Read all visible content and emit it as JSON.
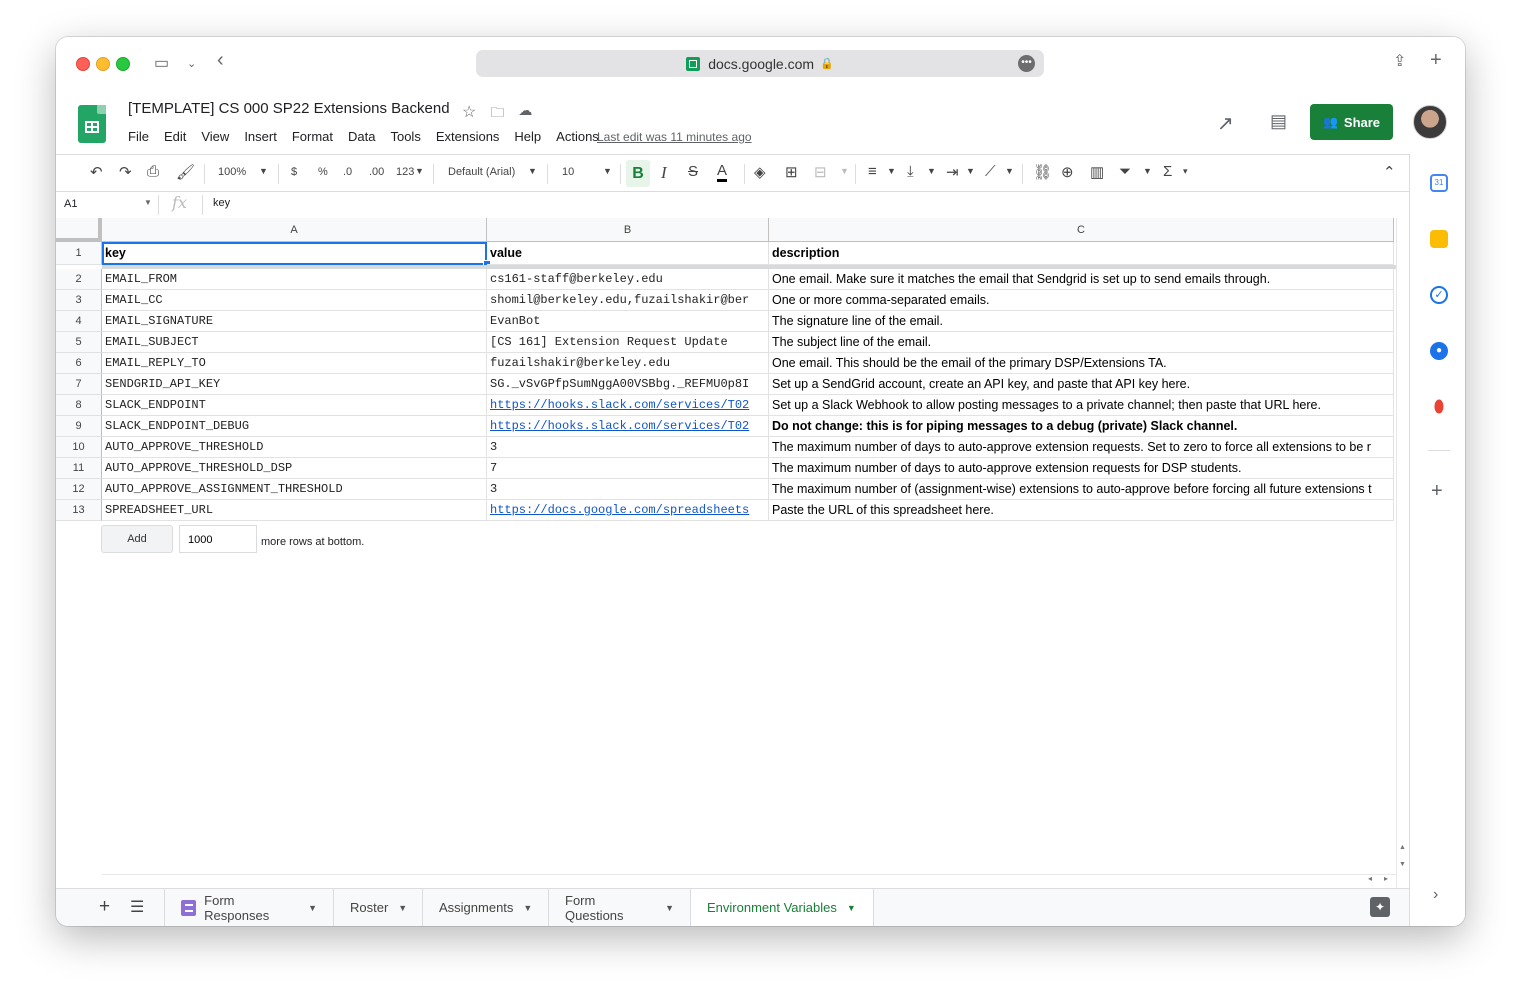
{
  "browser": {
    "url": "docs.google.com"
  },
  "doc": {
    "title": "[TEMPLATE] CS 000 SP22 Extensions Backend",
    "menu": [
      "File",
      "Edit",
      "View",
      "Insert",
      "Format",
      "Data",
      "Tools",
      "Extensions",
      "Help",
      "Actions"
    ],
    "last_edit": "Last edit was 11 minutes ago",
    "share_label": "Share"
  },
  "toolbar": {
    "zoom": "100%",
    "currency": "$",
    "percent": "%",
    "dec_decrease": ".0",
    "dec_increase": ".00",
    "more_formats": "123",
    "font": "Default (Arial)",
    "font_size": "10",
    "bold": "B",
    "italic": "I",
    "strike": "S",
    "text_color": "A"
  },
  "formula_bar": {
    "cell_ref": "A1",
    "fx": "fx",
    "value": "key"
  },
  "columns": [
    "A",
    "B",
    "C"
  ],
  "rows": [
    {
      "n": "1",
      "key": "key",
      "value": "value",
      "description": "description"
    },
    {
      "n": "2",
      "key": "EMAIL_FROM",
      "value": "cs161-staff@berkeley.edu",
      "description": "One email. Make sure it matches the email that Sendgrid is set up to send emails through."
    },
    {
      "n": "3",
      "key": "EMAIL_CC",
      "value": "shomil@berkeley.edu,fuzailshakir@ber",
      "description": "One or more comma-separated emails."
    },
    {
      "n": "4",
      "key": "EMAIL_SIGNATURE",
      "value": "EvanBot",
      "description": "The signature line of the email."
    },
    {
      "n": "5",
      "key": "EMAIL_SUBJECT",
      "value": "[CS 161] Extension Request Update",
      "description": "The subject line of the email."
    },
    {
      "n": "6",
      "key": "EMAIL_REPLY_TO",
      "value": "fuzailshakir@berkeley.edu",
      "description": "One email. This should be the email of the primary DSP/Extensions TA."
    },
    {
      "n": "7",
      "key": "SENDGRID_API_KEY",
      "value": "SG._vSvGPfpSumNggA00VSBbg._REFMU0p8I",
      "description": "Set up a SendGrid account, create an API key, and paste that API key here."
    },
    {
      "n": "8",
      "key": "SLACK_ENDPOINT",
      "value": "https://hooks.slack.com/services/T02",
      "description": "Set up a Slack Webhook to allow posting messages to a private channel; then paste that URL here."
    },
    {
      "n": "9",
      "key": "SLACK_ENDPOINT_DEBUG",
      "value": "https://hooks.slack.com/services/T02",
      "description": "Do not change: this is for piping messages to a debug (private) Slack channel."
    },
    {
      "n": "10",
      "key": "AUTO_APPROVE_THRESHOLD",
      "value": "3",
      "description": "The maximum number of days to auto-approve extension requests. Set to zero to force all extensions to be r"
    },
    {
      "n": "11",
      "key": "AUTO_APPROVE_THRESHOLD_DSP",
      "value": "7",
      "description": "The maximum number of days to auto-approve extension requests for DSP students."
    },
    {
      "n": "12",
      "key": "AUTO_APPROVE_ASSIGNMENT_THRESHOLD",
      "value": "3",
      "description": "The maximum number of (assignment-wise) extensions to auto-approve before forcing all future extensions t"
    },
    {
      "n": "13",
      "key": "SPREADSHEET_URL",
      "value": "https://docs.google.com/spreadsheets",
      "description": "Paste the URL of this spreadsheet here."
    }
  ],
  "add_rows": {
    "button": "Add",
    "count": "1000",
    "label": "more rows at bottom."
  },
  "tabs": [
    "Form Responses",
    "Roster",
    "Assignments",
    "Form Questions",
    "Environment Variables"
  ],
  "active_tab": "Environment Variables",
  "colors": {
    "brand_green": "#188038",
    "selection_blue": "#1a73e8",
    "link_blue": "#1155cc"
  }
}
